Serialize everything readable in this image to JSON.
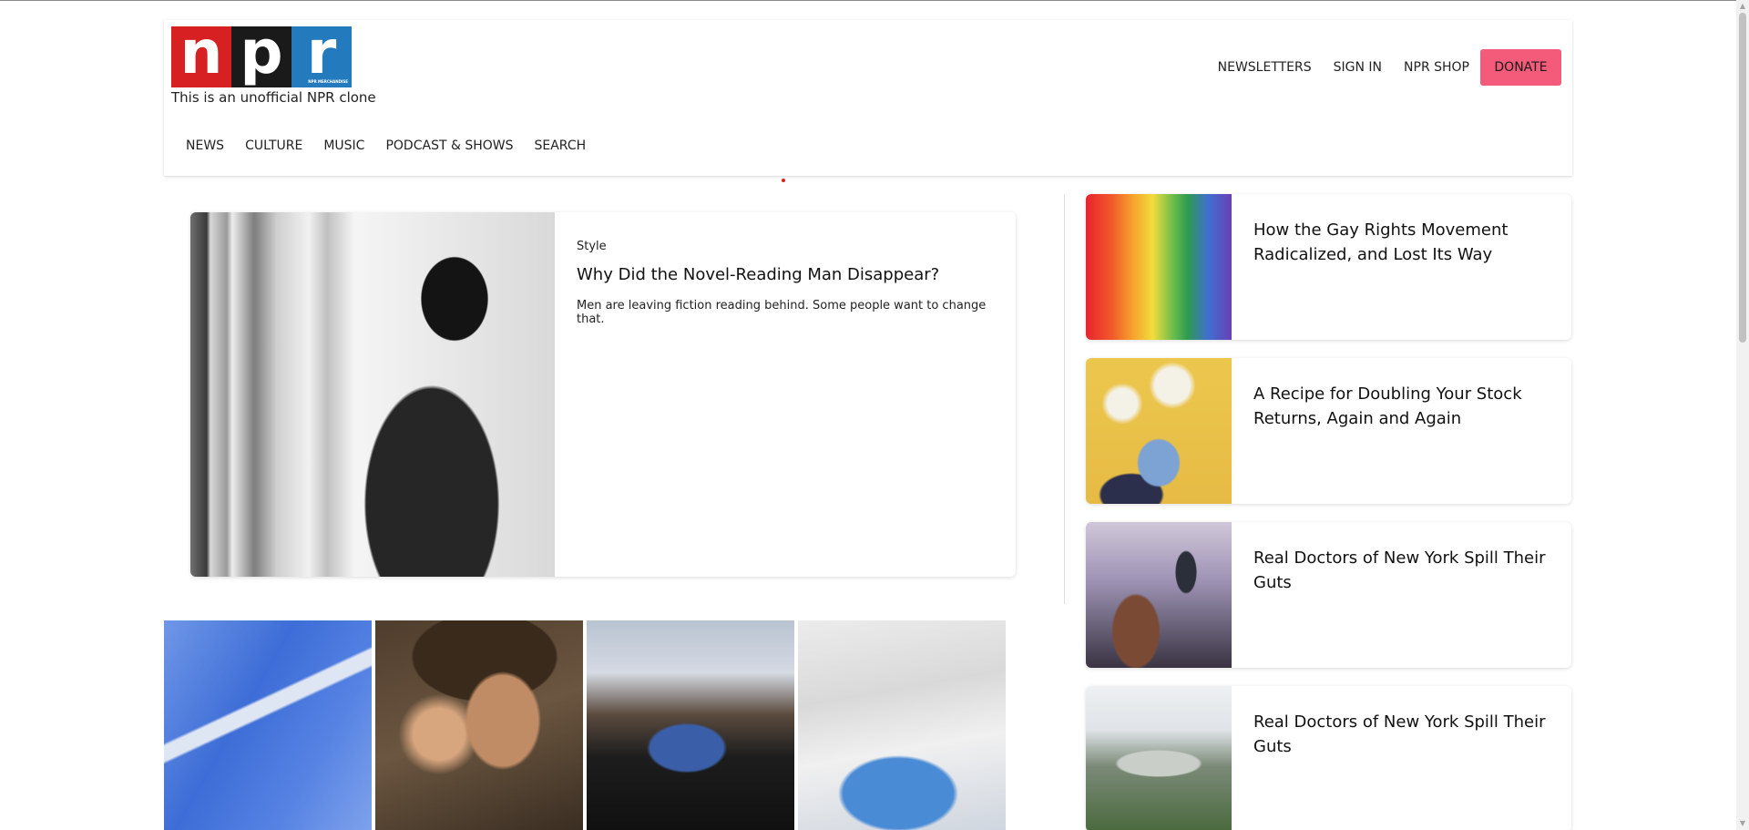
{
  "header": {
    "logo": {
      "letters": [
        "n",
        "p",
        "r"
      ],
      "small_text": "NPR MERCHANDISE"
    },
    "tagline": "This is an unofficial NPR clone",
    "main_nav": [
      "NEWS",
      "CULTURE",
      "MUSIC",
      "PODCAST & SHOWS",
      "SEARCH"
    ],
    "util_nav": [
      "NEWSLETTERS",
      "SIGN IN",
      "NPR SHOP"
    ],
    "donate_label": "DONATE"
  },
  "featured": {
    "kicker": "Style",
    "title": "Why Did the Novel-Reading Man Disappear?",
    "description": "Men are leaving fiction reading behind. Some people want to change that."
  },
  "sidebar_stories": [
    {
      "title": "How the Gay Rights Movement Radicalized, and Lost Its Way"
    },
    {
      "title": "A Recipe for Doubling Your Stock Returns, Again and Again"
    },
    {
      "title": "Real Doctors of New York Spill Their Guts"
    },
    {
      "title": "Real Doctors of New York Spill Their Guts"
    }
  ],
  "colors": {
    "npr_red": "#d62021",
    "npr_black": "#1a1a1a",
    "npr_blue": "#237bbd",
    "donate": "#f45b7a"
  }
}
